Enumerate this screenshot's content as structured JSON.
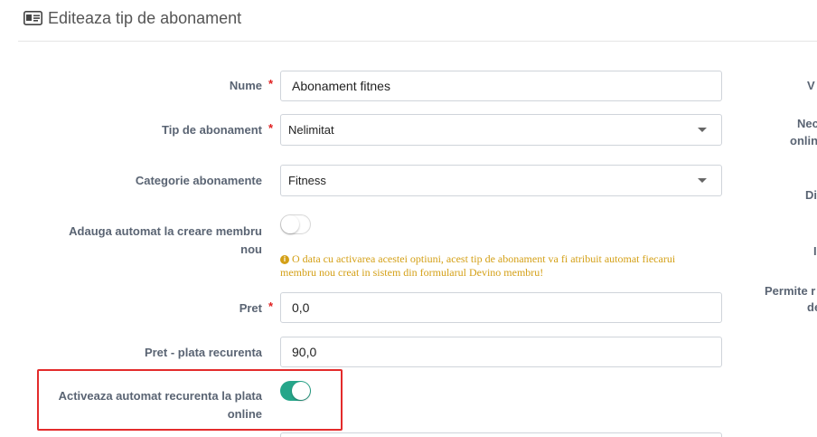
{
  "header": {
    "title": "Editeaza tip de abonament",
    "icon": "id-card-icon"
  },
  "form": {
    "nume": {
      "label": "Nume",
      "required": "*",
      "value": "Abonament fitnes"
    },
    "tip": {
      "label": "Tip de abonament",
      "required": "*",
      "value": "Nelimitat"
    },
    "categorie": {
      "label": "Categorie abonamente",
      "value": "Fitness"
    },
    "adauga": {
      "label_line1": "Adauga automat la creare membru",
      "label_line2": "nou",
      "toggle": "off",
      "hint": "O data cu activarea acestei optiuni, acest tip de abonament va fi atribuit automat fiecarui membru nou creat in sistem din formularul Devino membru!"
    },
    "pret": {
      "label": "Pret",
      "required": "*",
      "value": "0,0"
    },
    "pret_recurent": {
      "label": "Pret - plata recurenta",
      "value": "90,0"
    },
    "activeaza": {
      "label_line1": "Activeaza automat recurenta la plata",
      "label_line2": "online",
      "toggle": "on"
    }
  },
  "right_column": {
    "l1": "V",
    "l2a": "Nec",
    "l2b": "onlin",
    "l3": "Di",
    "l4": "I",
    "l5a": "Permite r",
    "l5b": "de"
  },
  "colors": {
    "accent": "#26a68a",
    "required": "#e02020",
    "hint": "#d4a017",
    "highlight": "#e32b2b"
  }
}
